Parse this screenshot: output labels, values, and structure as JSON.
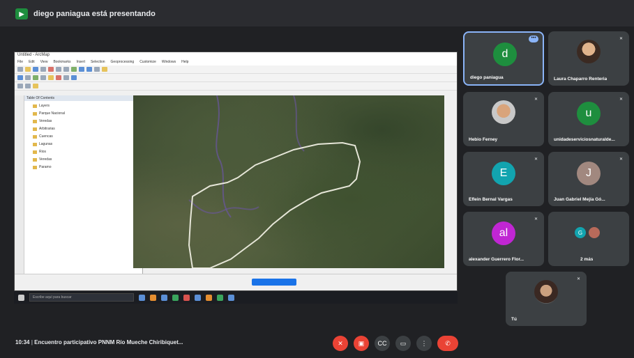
{
  "presenting": {
    "label": "diego paniagua está presentando"
  },
  "participants": [
    {
      "name": "diego paniagua",
      "initial": "d",
      "color": "#1e8e3e"
    },
    {
      "name": "Laura Chaparro Renteria",
      "initial": "",
      "color": ""
    },
    {
      "name": "Hebio Ferney",
      "initial": "",
      "color": ""
    },
    {
      "name": "unidadeserviciosnaturalde...",
      "initial": "u",
      "color": "#1e8e3e"
    },
    {
      "name": "Eflein Bernal Vargas",
      "initial": "E",
      "color": "#12a4af"
    },
    {
      "name": "Juan Gabriel Mejía Gó...",
      "initial": "J",
      "color": "#a1887f"
    },
    {
      "name": "alexander Guerrero Flor...",
      "initial": "al",
      "color": "#c026d3"
    },
    {
      "name": "2 más",
      "initial": "G",
      "color": "#12a4af"
    },
    {
      "name": "Tú",
      "initial": "",
      "color": ""
    }
  ],
  "share": {
    "app_title": "Untitled - ArcMap",
    "menu": [
      "File",
      "Edit",
      "View",
      "Bookmarks",
      "Insert",
      "Selection",
      "Geoprocessing",
      "Customize",
      "Windows",
      "Help"
    ],
    "toc_title": "Table Of Contents",
    "toc_items": [
      "Layers",
      "Parque Nacional",
      "Veredas",
      "Arbitrarias",
      "Cuencas",
      "Lagunas",
      "Rios",
      "Veredas",
      "Paramo"
    ],
    "taskbar_search": "Escribe aquí para buscar"
  },
  "meeting": {
    "time": "10:34",
    "title": "Encuentro participativo PNNM Río Mueche Chiribiquet..."
  },
  "controls": [
    "mic-off",
    "camera-off",
    "captions",
    "present",
    "more",
    "leave"
  ]
}
